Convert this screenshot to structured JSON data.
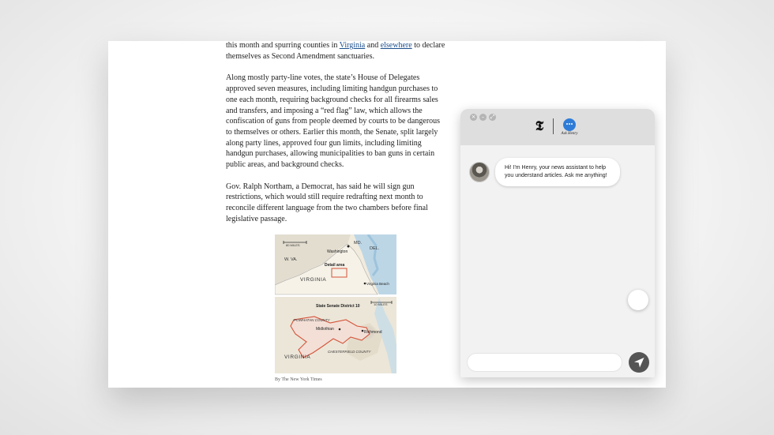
{
  "article": {
    "p1_pre": "this month and spurring counties in ",
    "p1_link1": "Virginia",
    "p1_and": " and ",
    "p1_link2": "elsewhere",
    "p1_post": " to declare themselves as Second Amendment sanctuaries.",
    "p2": "Along mostly party-line votes, the state’s House of Delegates approved seven measures, including limiting handgun purchases to one each month, requiring background checks for all firearms sales and transfers, and imposing a “red flag” law, which allows the confiscation of guns from people deemed by courts to be dangerous to themselves or others. Earlier this month, the Senate, split largely along party lines, approved four gun limits, including limiting handgun purchases, allowing municipalities to ban guns in certain public areas, and background checks.",
    "p3": "Gov. Ralph Northam, a Democrat, has said he will sign gun restrictions, which would still require redrafting next month to reconcile different language from the two chambers before final legislative passage."
  },
  "map": {
    "top": {
      "scale": "80 MILES",
      "md": "MD.",
      "del": "DEL.",
      "wva": "W. VA.",
      "washington": "Washington",
      "detail": "Detail area",
      "virginia": "VIRGINIA",
      "virginia_beach": "Virginia Beach"
    },
    "bottom": {
      "district": "State Senate District 10",
      "scale": "10 MILES",
      "powhatan": "POWHATAN COUNTY",
      "midlothian": "Midlothian",
      "richmond": "Richmond",
      "chesterfield": "CHESTERFIELD COUNTY",
      "virginia": "VIRGINIA"
    },
    "caption": "By The New York Times"
  },
  "chat": {
    "close_glyph": "×",
    "min_glyph": "–",
    "max_glyph": "⤢",
    "logo": "𝕿",
    "bot_name": "Ask Henry",
    "message_line1": "Hi! I'm Henry, your news assistant to help",
    "message_line2": "you understand articles. Ask me anything!",
    "input_value": ""
  },
  "colors": {
    "link": "#1a4e8c",
    "henry_blue": "#2f7cd8",
    "send_button": "#555555",
    "district_outline": "#d4533a"
  }
}
